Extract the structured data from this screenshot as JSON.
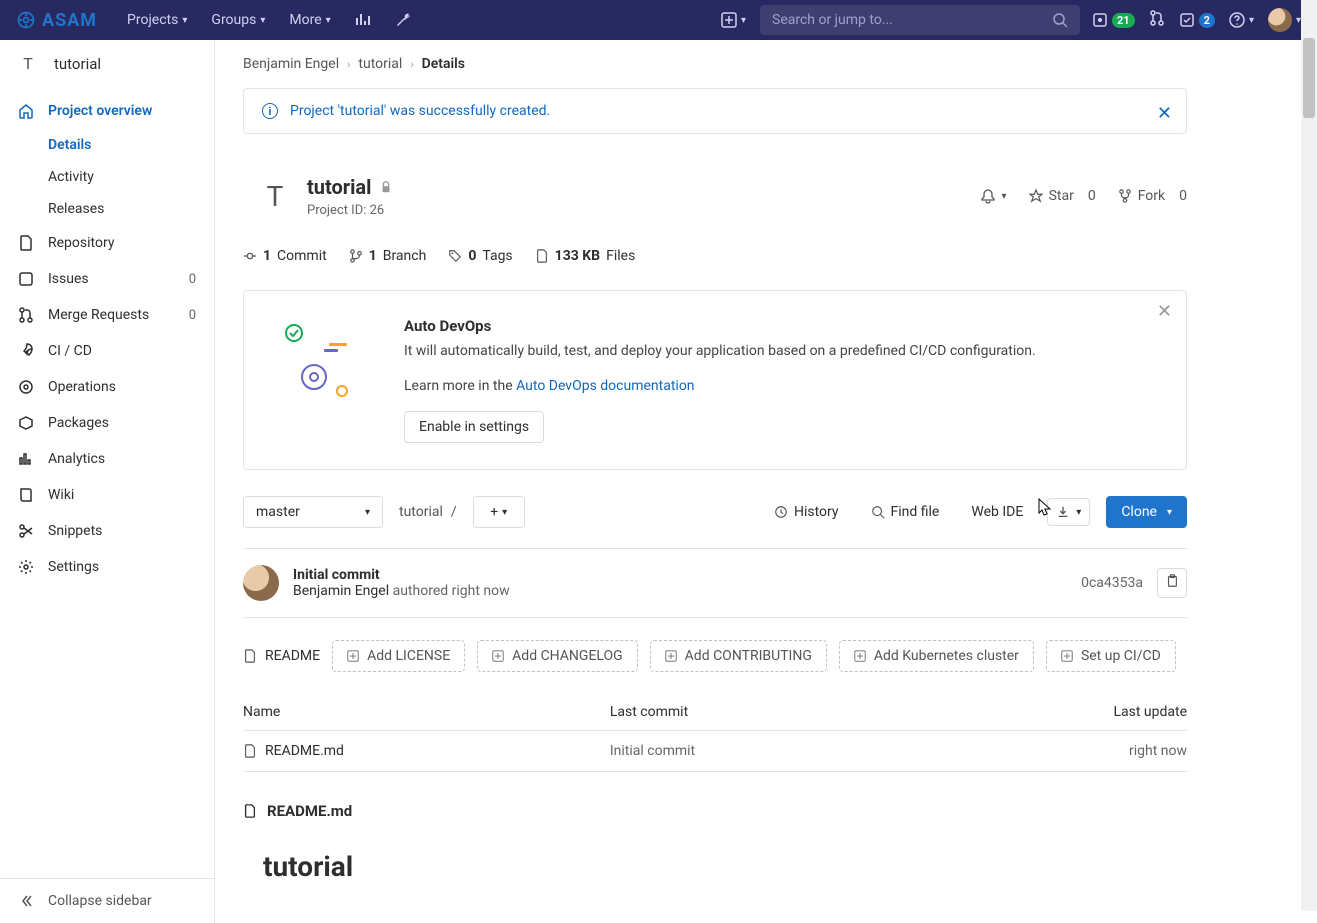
{
  "logo_text": "ASAM",
  "topnav": {
    "projects": "Projects",
    "groups": "Groups",
    "more": "More"
  },
  "search_placeholder": "Search or jump to...",
  "topright": {
    "issues_count": "21",
    "todos_count": "2"
  },
  "context": {
    "avatar_letter": "T",
    "project_name": "tutorial"
  },
  "breadcrumb": {
    "user": "Benjamin Engel",
    "project": "tutorial",
    "page": "Details"
  },
  "sidebar": {
    "overview": "Project overview",
    "details": "Details",
    "activity": "Activity",
    "releases": "Releases",
    "repository": "Repository",
    "issues": "Issues",
    "issues_count": "0",
    "merge_requests": "Merge Requests",
    "mr_count": "0",
    "cicd": "CI / CD",
    "operations": "Operations",
    "packages": "Packages",
    "analytics": "Analytics",
    "wiki": "Wiki",
    "snippets": "Snippets",
    "settings": "Settings",
    "collapse": "Collapse sidebar"
  },
  "flash": {
    "message": "Project 'tutorial' was successfully created."
  },
  "project": {
    "name": "tutorial",
    "id_label": "Project ID: 26",
    "star": "Star",
    "star_count": "0",
    "fork": "Fork",
    "fork_count": "0"
  },
  "stats": {
    "commits_n": "1",
    "commits": "Commit",
    "branches_n": "1",
    "branches": "Branch",
    "tags_n": "0",
    "tags": "Tags",
    "size_n": "133 KB",
    "size": "Files"
  },
  "devops": {
    "title": "Auto DevOps",
    "body": "It will automatically build, test, and deploy your application based on a predefined CI/CD configuration.",
    "learn_prefix": "Learn more in the ",
    "learn_link": "Auto DevOps documentation",
    "enable": "Enable in settings"
  },
  "repo_toolbar": {
    "branch": "master",
    "path": "tutorial",
    "history": "History",
    "find_file": "Find file",
    "web_ide": "Web IDE",
    "clone": "Clone"
  },
  "commit": {
    "message": "Initial commit",
    "author": "Benjamin Engel",
    "authored": "authored right now",
    "sha": "0ca4353a"
  },
  "quickactions": {
    "readme": "README",
    "license": "Add LICENSE",
    "changelog": "Add CHANGELOG",
    "contributing": "Add CONTRIBUTING",
    "k8s": "Add Kubernetes cluster",
    "cicd": "Set up CI/CD"
  },
  "files": {
    "headers": {
      "name": "Name",
      "last_commit": "Last commit",
      "last_update": "Last update"
    },
    "rows": [
      {
        "name": "README.md",
        "commit": "Initial commit",
        "updated": "right now"
      }
    ]
  },
  "readme": {
    "filename": "README.md",
    "heading": "tutorial"
  }
}
